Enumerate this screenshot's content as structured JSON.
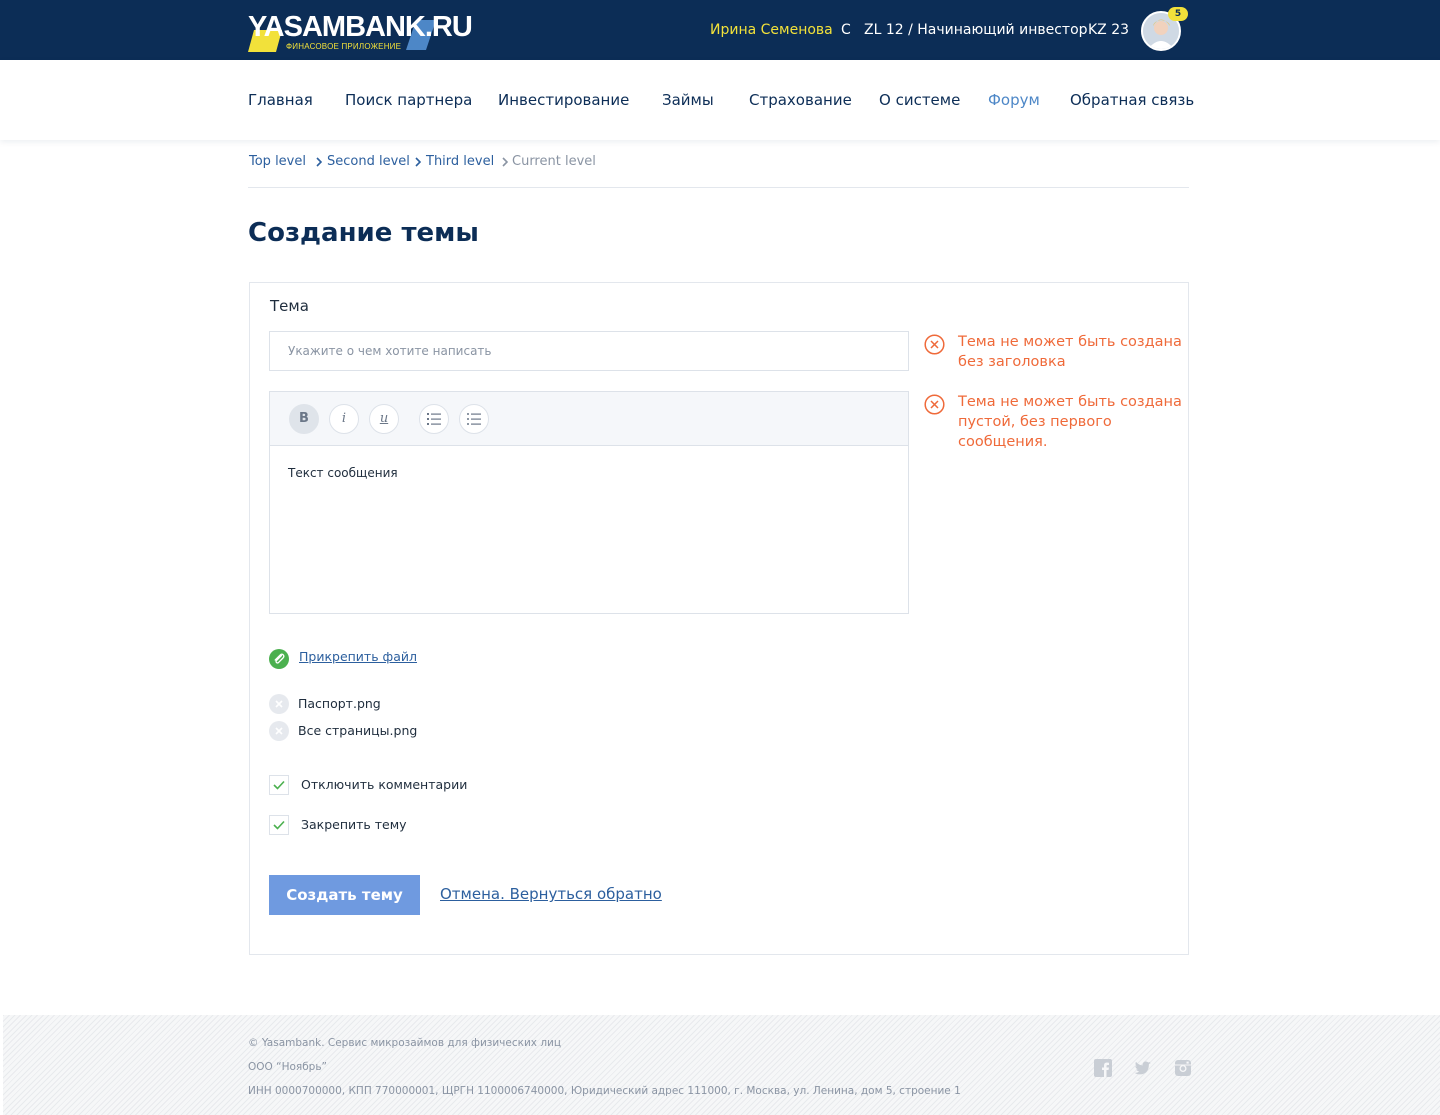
{
  "header": {
    "logo_text": "YASAMBANK.RU",
    "logo_subtitle": "ФИНАСОВОЕ ПРИЛОЖЕНИЕ",
    "user_name": "Ирина Семенова",
    "user_c": "С",
    "user_level": "ZL 12 / Начинающий инвестор",
    "user_kz": "KZ 23",
    "notifications_count": "5"
  },
  "nav": {
    "items": [
      {
        "label": "Главная"
      },
      {
        "label": "Поиск партнера"
      },
      {
        "label": "Инвестирование"
      },
      {
        "label": "Займы"
      },
      {
        "label": "Страхование"
      },
      {
        "label": "О системе"
      },
      {
        "label": "Форум"
      },
      {
        "label": "Обратная связь"
      }
    ],
    "active": "Форум"
  },
  "breadcrumb": {
    "items": [
      "Top level",
      "Second level",
      "Third level",
      "Current level"
    ]
  },
  "page": {
    "title": "Создание темы"
  },
  "form": {
    "topic_label": "Тема",
    "topic_placeholder": "Укажите о чем хотите написать",
    "topic_value": "",
    "toolbar": {
      "bold": "B",
      "italic": "i",
      "underline": "u"
    },
    "message_text": "Текст сообщения",
    "errors": [
      "Тема не может быть создана без заголовка",
      "Тема не может быть создана пустой, без первого сообщения."
    ],
    "attach_label": "Прикрепить файл",
    "files": [
      "Паспорт.png",
      "Все страницы.png"
    ],
    "checkboxes": [
      {
        "label": "Отключить комментарии",
        "checked": true
      },
      {
        "label": "Закрепить тему",
        "checked": true
      }
    ],
    "submit_label": "Создать тему",
    "cancel_label": "Отмена. Вернуться обратно"
  },
  "footer": {
    "line1": "© Yasambank. Сервис микрозаймов для физических лиц",
    "line2": "ООО “Ноябрь”",
    "line3": "ИНН 0000700000, КПП 770000001, ЩРГН 1100006740000, Юридический адрес 111000, г. Москва, ул. Ленина, дом 5, строение 1",
    "social": [
      "facebook-icon",
      "twitter-icon",
      "instagram-icon"
    ]
  },
  "colors": {
    "topbar": "#0c2d56",
    "accent_yellow": "#f2e13a",
    "link_blue": "#2c5f9e",
    "nav_active": "#4d87c7",
    "error_orange": "#ef6a3a",
    "primary_button": "#6f9ae0",
    "attach_green": "#4bb04f"
  }
}
